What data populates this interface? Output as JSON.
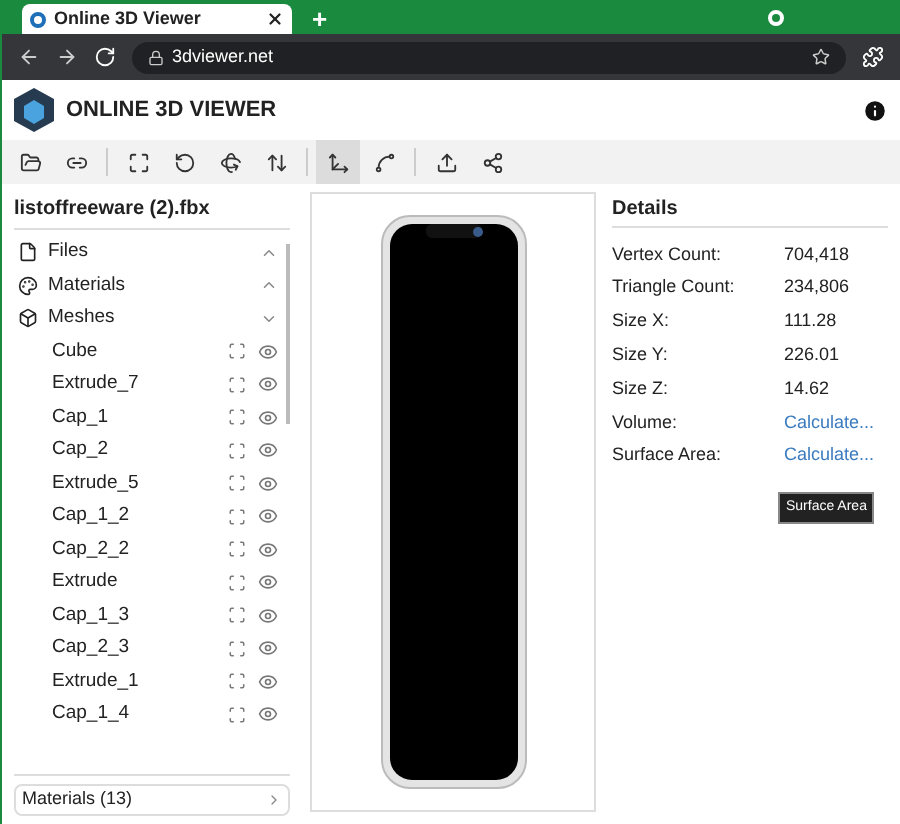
{
  "browser": {
    "tab_title": "Online 3D Viewer",
    "new_tab": "+",
    "address": "3dviewer.net"
  },
  "app": {
    "title": "ONLINE 3D VIEWER"
  },
  "toolbar": [
    {
      "kind": "open",
      "selected": false
    },
    {
      "kind": "open-url",
      "selected": false
    },
    {
      "kind": "fit",
      "selected": false
    },
    {
      "kind": "rotate-y",
      "selected": false
    },
    {
      "kind": "rotate-z",
      "selected": false
    },
    {
      "kind": "flip",
      "selected": false
    },
    {
      "kind": "fixed-up",
      "selected": true
    },
    {
      "kind": "free",
      "selected": false
    },
    {
      "kind": "export",
      "selected": false
    },
    {
      "kind": "share",
      "selected": false
    }
  ],
  "sidebar": {
    "title": "listoffreeware (2).fbx",
    "sections": [
      {
        "kind": "file",
        "label": "Files",
        "expanded": false
      },
      {
        "kind": "material",
        "label": "Materials",
        "expanded": false
      },
      {
        "kind": "mesh",
        "label": "Meshes",
        "expanded": true
      }
    ],
    "meshes": [
      "Cube",
      "Extrude_7",
      "Cap_1",
      "Cap_2",
      "Extrude_5",
      "Cap_1_2",
      "Cap_2_2",
      "Extrude",
      "Cap_1_3",
      "Cap_2_3",
      "Extrude_1",
      "Cap_1_4"
    ],
    "footer": "Materials (13)"
  },
  "details": {
    "title": "Details",
    "rows": [
      {
        "label": "Vertex Count:",
        "value": "704,418",
        "kind": "text"
      },
      {
        "label": "Triangle Count:",
        "value": "234,806",
        "kind": "text"
      },
      {
        "label": "Size X:",
        "value": "111.28",
        "kind": "text"
      },
      {
        "label": "Size Y:",
        "value": "226.01",
        "kind": "text"
      },
      {
        "label": "Size Z:",
        "value": "14.62",
        "kind": "text"
      },
      {
        "label": "Volume:",
        "value": "Calculate...",
        "kind": "link"
      },
      {
        "label": "Surface Area:",
        "value": "Calculate...",
        "kind": "link"
      }
    ],
    "tooltip": "Surface Area"
  }
}
